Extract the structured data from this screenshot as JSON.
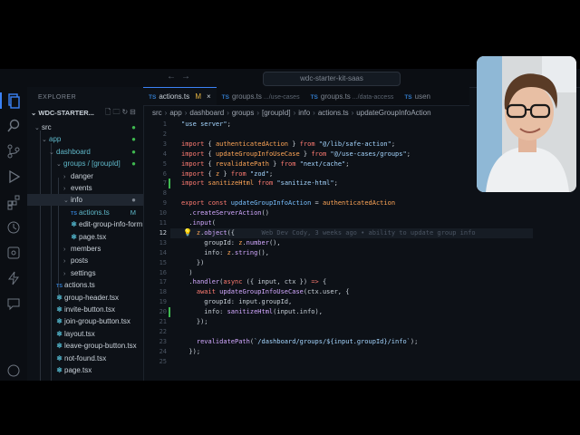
{
  "titlebar": {
    "search": "wdc-starter-kit-saas",
    "back": "←",
    "forward": "→"
  },
  "sidebar": {
    "title": "EXPLORER",
    "root": "WDC-STARTER...",
    "tree": [
      {
        "label": "src",
        "arrow": "⌄",
        "type": "folder",
        "depth": 1,
        "marker": "●",
        "color": "#c9d1d9",
        "marker_color": "#3fb950"
      },
      {
        "label": "app",
        "arrow": "⌄",
        "type": "folder",
        "depth": 2,
        "marker": "●",
        "color": "#5fb8c9",
        "marker_color": "#3fb950"
      },
      {
        "label": "dashboard",
        "arrow": "⌄",
        "type": "folder",
        "depth": 3,
        "marker": "●",
        "color": "#5fb8c9",
        "marker_color": "#3fb950"
      },
      {
        "label": "groups / [groupId]",
        "arrow": "⌄",
        "type": "folder",
        "depth": 4,
        "marker": "●",
        "color": "#5fb8c9",
        "marker_color": "#3fb950"
      },
      {
        "label": "danger",
        "arrow": "›",
        "type": "folder",
        "depth": 5,
        "marker": "",
        "color": "#c9d1d9"
      },
      {
        "label": "events",
        "arrow": "›",
        "type": "folder",
        "depth": 5,
        "marker": "",
        "color": "#c9d1d9"
      },
      {
        "label": "info",
        "arrow": "⌄",
        "type": "folder",
        "depth": 5,
        "marker": "●",
        "color": "#c9d1d9",
        "marker_color": "#7d8590",
        "selected": true
      },
      {
        "label": "actions.ts",
        "type": "ts",
        "depth": 6,
        "badge": "M",
        "color": "#5fb8c9"
      },
      {
        "label": "edit-group-info-form...",
        "type": "tsx",
        "depth": 6,
        "color": "#c9d1d9"
      },
      {
        "label": "page.tsx",
        "type": "tsx",
        "depth": 6,
        "color": "#c9d1d9"
      },
      {
        "label": "members",
        "arrow": "›",
        "type": "folder",
        "depth": 5,
        "color": "#c9d1d9"
      },
      {
        "label": "posts",
        "arrow": "›",
        "type": "folder",
        "depth": 5,
        "color": "#c9d1d9"
      },
      {
        "label": "settings",
        "arrow": "›",
        "type": "folder",
        "depth": 5,
        "color": "#c9d1d9"
      },
      {
        "label": "actions.ts",
        "type": "ts",
        "depth": 4,
        "color": "#c9d1d9"
      },
      {
        "label": "group-header.tsx",
        "type": "tsx",
        "depth": 4,
        "color": "#c9d1d9"
      },
      {
        "label": "invite-button.tsx",
        "type": "tsx",
        "depth": 4,
        "color": "#c9d1d9"
      },
      {
        "label": "join-group-button.tsx",
        "type": "tsx",
        "depth": 4,
        "color": "#c9d1d9"
      },
      {
        "label": "layout.tsx",
        "type": "tsx",
        "depth": 4,
        "color": "#c9d1d9"
      },
      {
        "label": "leave-group-button.tsx",
        "type": "tsx",
        "depth": 4,
        "color": "#c9d1d9"
      },
      {
        "label": "not-found.tsx",
        "type": "tsx",
        "depth": 4,
        "color": "#c9d1d9"
      },
      {
        "label": "page.tsx",
        "type": "tsx",
        "depth": 4,
        "color": "#c9d1d9"
      }
    ]
  },
  "tabs": [
    {
      "label": "actions.ts",
      "icon": "TS",
      "desc": "",
      "modified": "M",
      "active": true
    },
    {
      "label": "groups.ts",
      "icon": "TS",
      "desc": ".../use-cases",
      "active": false
    },
    {
      "label": "groups.ts",
      "icon": "TS",
      "desc": ".../data-access",
      "active": false
    },
    {
      "label": "usen",
      "icon": "TS",
      "desc": "",
      "active": false
    }
  ],
  "breadcrumb": [
    "src",
    "app",
    "dashboard",
    "groups",
    "[groupId]",
    "info",
    "actions.ts",
    "updateGroupInfoAction"
  ],
  "code": [
    {
      "n": "1",
      "html": "<span class=\"s\">\"use server\"</span>;"
    },
    {
      "n": "2",
      "html": ""
    },
    {
      "n": "3",
      "html": "<span class=\"k\">import</span> { <span class=\"v\">authenticatedAction</span> } <span class=\"k\">from</span> <span class=\"s\">\"@/lib/safe-action\"</span>;"
    },
    {
      "n": "4",
      "html": "<span class=\"k\">import</span> { <span class=\"v\">updateGroupInfoUseCase</span> } <span class=\"k\">from</span> <span class=\"s\">\"@/use-cases/groups\"</span>;"
    },
    {
      "n": "5",
      "html": "<span class=\"k\">import</span> { <span class=\"v\">revalidatePath</span> } <span class=\"k\">from</span> <span class=\"s\">\"next/cache\"</span>;"
    },
    {
      "n": "6",
      "html": "<span class=\"k\">import</span> { <span class=\"v\">z</span> } <span class=\"k\">from</span> <span class=\"s\">\"zod\"</span>;"
    },
    {
      "n": "7",
      "html": "<span class=\"k\">import</span> <span class=\"v\">sanitizeHtml</span> <span class=\"k\">from</span> <span class=\"s\">\"sanitize-html\"</span>;",
      "mod": true
    },
    {
      "n": "8",
      "html": ""
    },
    {
      "n": "9",
      "html": "<span class=\"k\">export const</span> <span class=\"p\">updateGroupInfoAction</span> = <span class=\"v\">authenticatedAction</span>"
    },
    {
      "n": "10",
      "html": "  .<span class=\"f\">createServerAction</span>()"
    },
    {
      "n": "11",
      "html": "  .<span class=\"f\">input</span>("
    },
    {
      "n": "12",
      "html": "    <span class=\"v\">z</span>.<span class=\"f\">object</span>({       <span class=\"blame\">Web Dev Cody, 3 weeks ago • ability to update group info</span>",
      "current": true
    },
    {
      "n": "13",
      "html": "      groupId: <span class=\"v\">z</span>.<span class=\"f\">number</span>(),"
    },
    {
      "n": "14",
      "html": "      info: <span class=\"v\">z</span>.<span class=\"f\">string</span>(),"
    },
    {
      "n": "15",
      "html": "    })"
    },
    {
      "n": "16",
      "html": "  )"
    },
    {
      "n": "17",
      "html": "  .<span class=\"f\">handler</span>(<span class=\"k\">async</span> ({ input, ctx }) <span class=\"k\">=></span> {"
    },
    {
      "n": "18",
      "html": "    <span class=\"k\">await</span> <span class=\"f\">updateGroupInfoUseCase</span>(ctx.user, {"
    },
    {
      "n": "19",
      "html": "      groupId: input.groupId,"
    },
    {
      "n": "20",
      "html": "      info: <span class=\"f\">sanitizeHtml</span>(input.info),",
      "mod": true
    },
    {
      "n": "21",
      "html": "    });"
    },
    {
      "n": "22",
      "html": ""
    },
    {
      "n": "23",
      "html": "    <span class=\"f\">revalidatePath</span>(<span class=\"s\">`/dashboard/groups/${input.groupId}/info`</span>);"
    },
    {
      "n": "24",
      "html": "  });"
    },
    {
      "n": "25",
      "html": ""
    }
  ],
  "colors": {
    "accent": "#3b82f6",
    "modified": "#3fb950",
    "string": "#a5d6ff",
    "keyword": "#ff7b72",
    "function": "#d2a8ff"
  }
}
